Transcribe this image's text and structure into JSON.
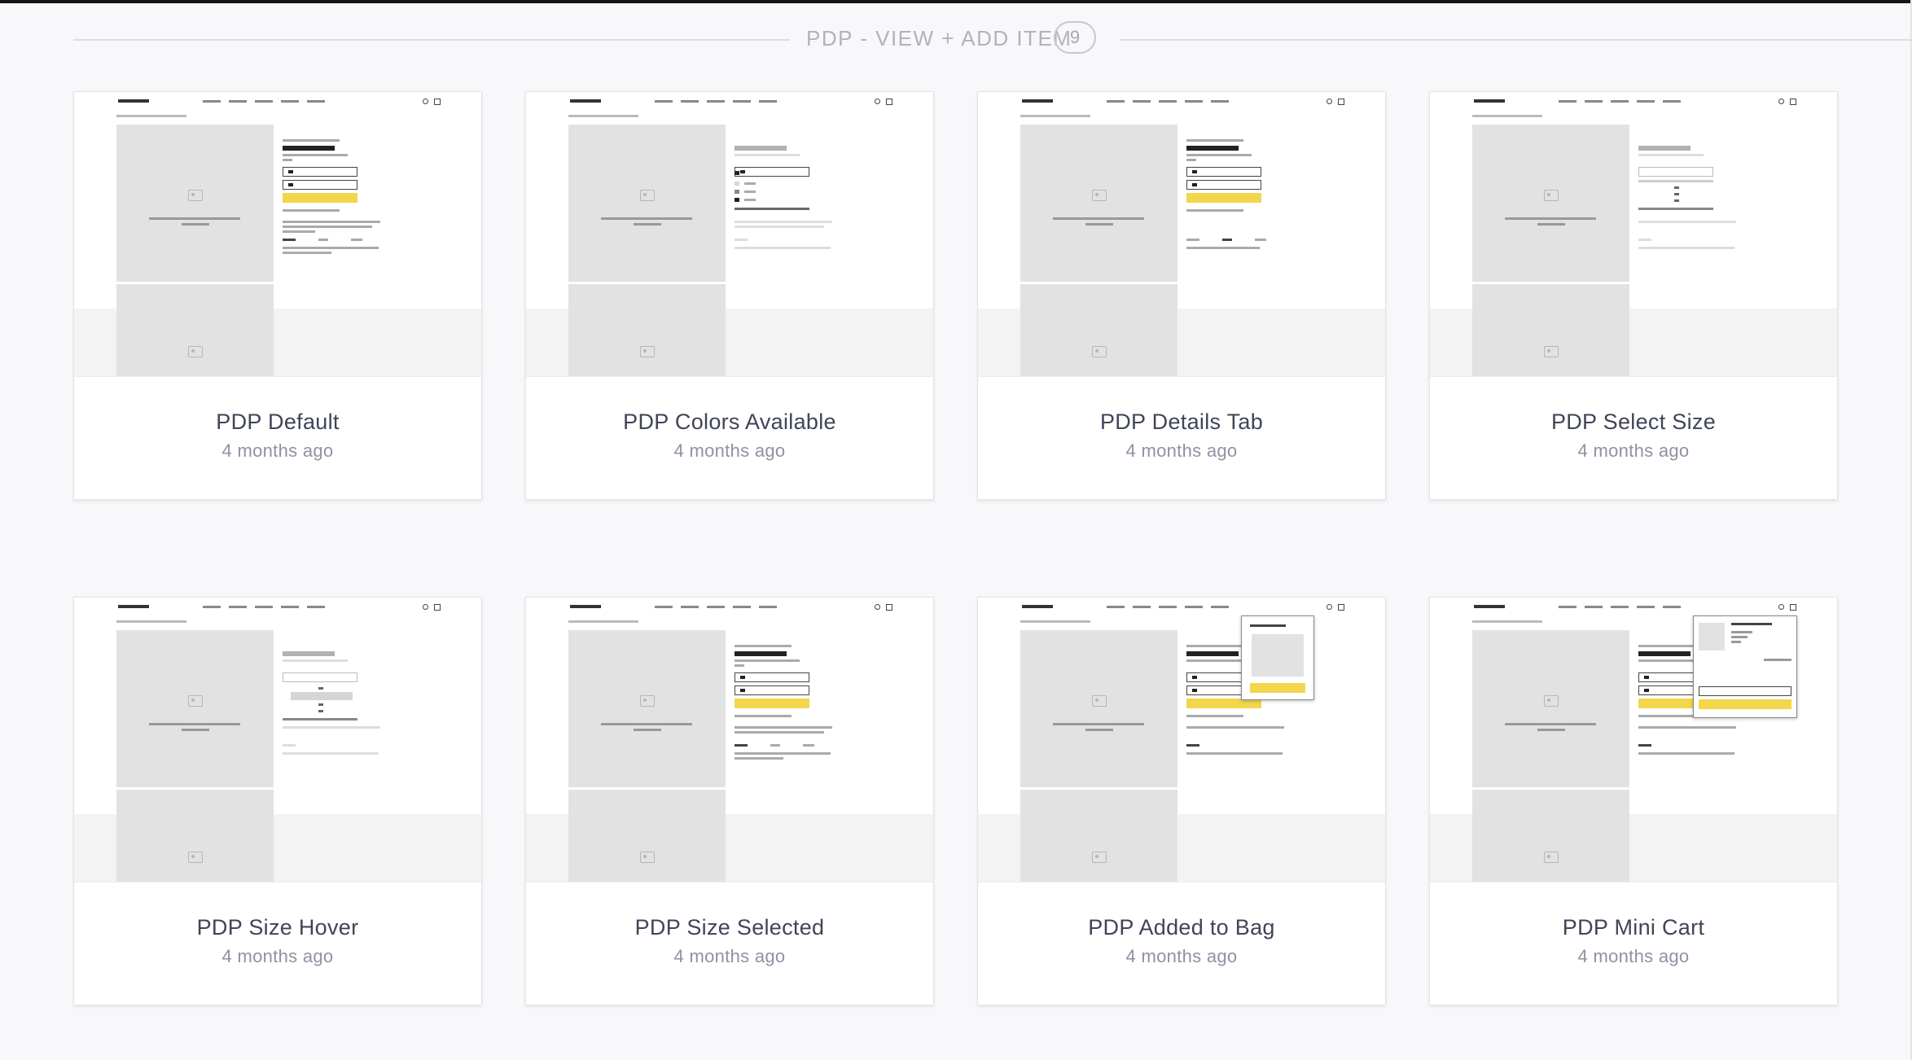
{
  "section": {
    "title": "PDP - VIEW + ADD ITEM",
    "count": "9"
  },
  "cards": [
    {
      "title": "PDP Default",
      "time": "4 months ago"
    },
    {
      "title": "PDP Colors Available",
      "time": "4 months ago"
    },
    {
      "title": "PDP Details Tab",
      "time": "4 months ago"
    },
    {
      "title": "PDP Select Size",
      "time": "4 months ago"
    },
    {
      "title": "PDP Size Hover",
      "time": "4 months ago"
    },
    {
      "title": "PDP Size Selected",
      "time": "4 months ago"
    },
    {
      "title": "PDP Added to Bag",
      "time": "4 months ago"
    },
    {
      "title": "PDP Mini Cart",
      "time": "4 months ago"
    }
  ],
  "colors": {
    "background": "#f8f8fa",
    "card_title": "#404458",
    "card_time": "#8e92a2",
    "accent_yellow": "#f2d64b",
    "image_placeholder": "#e2e2e2"
  },
  "icons": {
    "thumbnail_image_placeholder": "image-placeholder-icon",
    "thumbnail_search": "search-icon",
    "thumbnail_bag": "bag-icon"
  }
}
